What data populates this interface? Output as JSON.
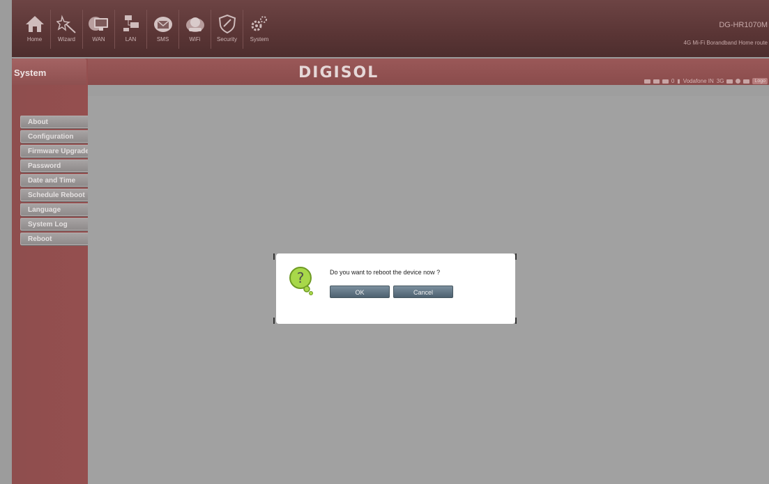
{
  "nav": {
    "items": [
      {
        "label": "Home",
        "icon": "home-icon"
      },
      {
        "label": "Wizard",
        "icon": "wand-icon"
      },
      {
        "label": "WAN",
        "icon": "monitor-icon"
      },
      {
        "label": "LAN",
        "icon": "network-icon"
      },
      {
        "label": "SMS",
        "icon": "envelope-icon"
      },
      {
        "label": "WiFi",
        "icon": "wifi-icon"
      },
      {
        "label": "Security",
        "icon": "shield-icon"
      },
      {
        "label": "System",
        "icon": "gears-icon"
      }
    ]
  },
  "header": {
    "model": "DG-HR1070M",
    "model_sub": "4G Mi-Fi Borandband Home route",
    "logo": "DIGISOL",
    "status": {
      "sms_count": "0",
      "operator": "Vodafone IN",
      "network": "3G",
      "logout_label": "Logo"
    }
  },
  "sidebar": {
    "title": "System",
    "items": [
      {
        "label": "About"
      },
      {
        "label": "Configuration"
      },
      {
        "label": "Firmware Upgrade"
      },
      {
        "label": "Password"
      },
      {
        "label": "Date and Time"
      },
      {
        "label": "Schedule Reboot"
      },
      {
        "label": "Language"
      },
      {
        "label": "System Log"
      },
      {
        "label": "Reboot"
      }
    ]
  },
  "dialog": {
    "message": "Do you want to reboot the device now ?",
    "ok_label": "OK",
    "cancel_label": "Cancel",
    "icon": "question-icon"
  }
}
